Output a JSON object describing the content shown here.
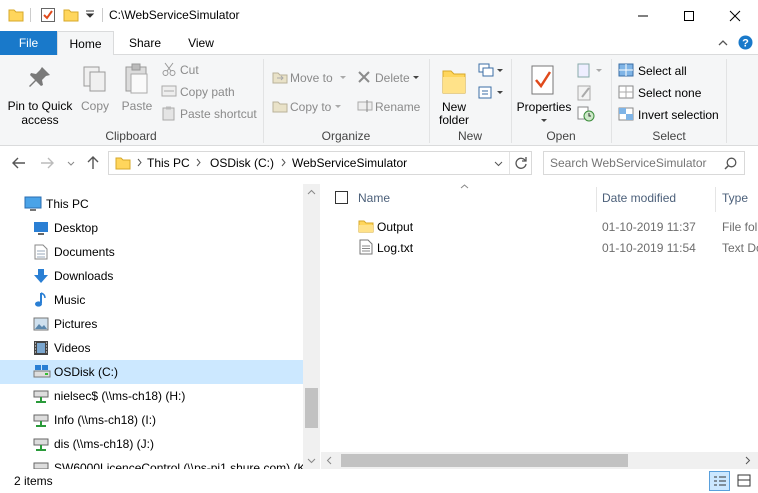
{
  "window": {
    "title": "C:\\WebServiceSimulator"
  },
  "ribbon_tabs": {
    "file": "File",
    "home": "Home",
    "share": "Share",
    "view": "View"
  },
  "ribbon": {
    "clipboard": {
      "pin_line1": "Pin to Quick",
      "pin_line2": "access",
      "copy": "Copy",
      "paste": "Paste",
      "cut": "Cut",
      "copy_path": "Copy path",
      "paste_shortcut": "Paste shortcut",
      "label": "Clipboard"
    },
    "organize": {
      "move_to": "Move to",
      "copy_to": "Copy to",
      "delete": "Delete",
      "rename": "Rename",
      "label": "Organize"
    },
    "new": {
      "new_folder_line1": "New",
      "new_folder_line2": "folder",
      "label": "New"
    },
    "open": {
      "properties": "Properties",
      "label": "Open"
    },
    "select": {
      "select_all": "Select all",
      "select_none": "Select none",
      "invert_selection": "Invert selection",
      "label": "Select"
    }
  },
  "address": {
    "crumbs": [
      "This PC",
      "OSDisk (C:)",
      "WebServiceSimulator"
    ],
    "search_placeholder": "Search WebServiceSimulator"
  },
  "nav": {
    "items": [
      {
        "label": "This PC",
        "icon": "pc-icon"
      },
      {
        "label": "Desktop",
        "icon": "desktop-icon"
      },
      {
        "label": "Documents",
        "icon": "documents-icon"
      },
      {
        "label": "Downloads",
        "icon": "downloads-icon"
      },
      {
        "label": "Music",
        "icon": "music-icon"
      },
      {
        "label": "Pictures",
        "icon": "pictures-icon"
      },
      {
        "label": "Videos",
        "icon": "videos-icon"
      },
      {
        "label": "OSDisk (C:)",
        "icon": "drive-icon",
        "selected": true
      },
      {
        "label": "nielsec$ (\\\\ms-ch18) (H:)",
        "icon": "network-drive-icon"
      },
      {
        "label": "Info (\\\\ms-ch18) (I:)",
        "icon": "network-drive-icon"
      },
      {
        "label": "dis (\\\\ms-ch18) (J:)",
        "icon": "network-drive-icon"
      },
      {
        "label": "SW6000LicenceControl (\\\\ps-pj1.shure.com) (K:",
        "icon": "network-drive-icon"
      }
    ]
  },
  "columns": {
    "name": "Name",
    "date_modified": "Date modified",
    "type": "Type"
  },
  "files": [
    {
      "name": "Output",
      "date": "01-10-2019 11:37",
      "type": "File fol",
      "icon": "folder-icon"
    },
    {
      "name": "Log.txt",
      "date": "01-10-2019 11:54",
      "type": "Text Do",
      "icon": "text-file-icon"
    }
  ],
  "status": {
    "item_count": "2 items"
  },
  "colors": {
    "accent": "#1979ca",
    "selection": "#cce8ff",
    "folder": "#ffd65c"
  }
}
